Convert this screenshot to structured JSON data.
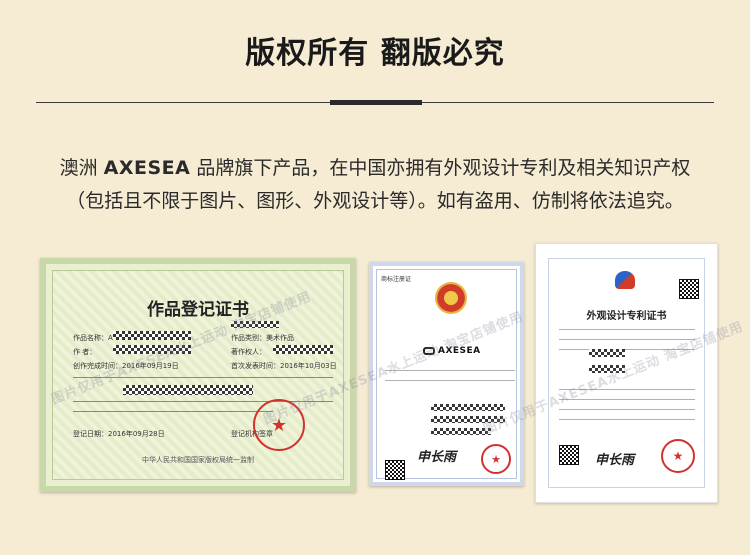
{
  "header": {
    "title": "版权所有 翻版必究"
  },
  "statement": {
    "line1_prefix": "澳洲",
    "brand": "AXESEA",
    "line1_suffix": "品牌旗下产品，在中国亦拥有外观设计专利及相关知识产权",
    "line2": "（包括且不限于图片、图形、外观设计等）。如有盗用、仿制将依法追究。"
  },
  "certificates": {
    "copyright": {
      "title": "作品登记证书",
      "work_name_label": "作品名称：",
      "work_name": "AXESEA",
      "category_label": "作品类别：美术作品",
      "author_label": "作    者：",
      "owner_label": "著作权人：",
      "completed_label": "创作完成时间：2016年09月19日",
      "published_label": "首次发表时间：2016年10月03日",
      "register_date": "登记日期：2016年09月28日",
      "register_org_label": "登记机构签章",
      "footer": "中华人民共和国国家版权局统一监制"
    },
    "trademark": {
      "header_label": "商标注册证",
      "logo_text": "AXESEA",
      "signature": "申长雨"
    },
    "patent": {
      "title": "外观设计专利证书",
      "signature": "申长雨"
    }
  },
  "watermark": {
    "text": "图片仅用于AXESEA水上运动 淘宝店铺使用"
  },
  "colors": {
    "background": "#f6ecd4",
    "seal_red": "#d2322d"
  }
}
